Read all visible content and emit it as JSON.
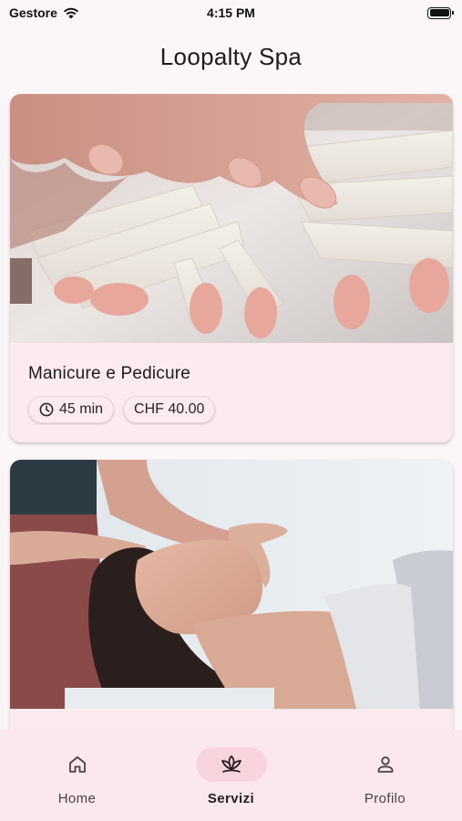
{
  "status_bar": {
    "carrier": "Gestore",
    "time": "4:15 PM",
    "icons": [
      "wifi-icon",
      "battery-icon"
    ]
  },
  "app_bar": {
    "title": "Loopalty Spa"
  },
  "services": [
    {
      "title": "Manicure e Pedicure",
      "duration": "45 min",
      "price": "CHF 40.00",
      "image": "manicure-photo"
    },
    {
      "title": "",
      "image": "facial-massage-photo"
    }
  ],
  "bottom_nav": {
    "items": [
      {
        "label": "Home",
        "icon": "home-icon",
        "active": false
      },
      {
        "label": "Servizi",
        "icon": "lotus-icon",
        "active": true
      },
      {
        "label": "Profilo",
        "icon": "person-icon",
        "active": false
      }
    ]
  },
  "colors": {
    "background": "#fbf6f8",
    "card": "#fbeaee",
    "nav_background": "#fbe8ec",
    "nav_indicator": "#f8d5dc"
  }
}
